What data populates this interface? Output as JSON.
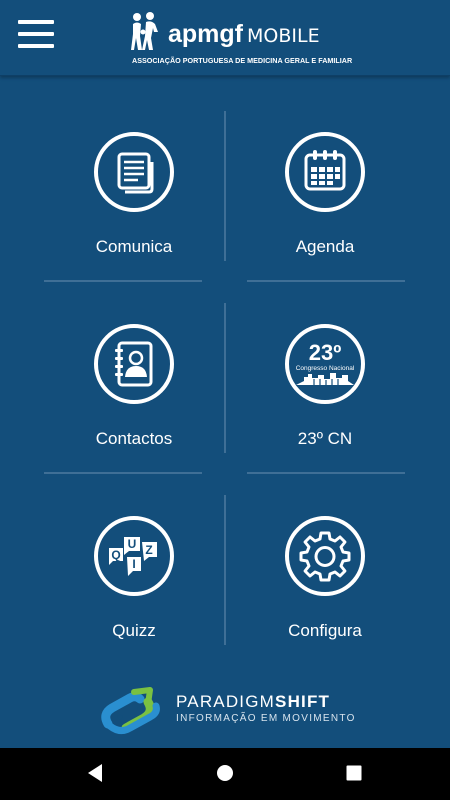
{
  "header": {
    "menu_icon": "hamburger-menu-icon",
    "logo_icon": "apmgf-figures-logo",
    "brand": "apmgf",
    "brand_suffix": "MOBILE",
    "brand_subtitle": "ASSOCIAÇÃO PORTUGUESA DE MEDICINA GERAL E FAMILIAR"
  },
  "menu": {
    "items": [
      {
        "label": "Comunica",
        "icon": "documents-icon"
      },
      {
        "label": "Agenda",
        "icon": "calendar-icon"
      },
      {
        "label": "Contactos",
        "icon": "address-book-icon"
      },
      {
        "label": "23º CN",
        "icon": "congress-badge-icon",
        "badge_number": "23º",
        "badge_text": "Congresso Nacional"
      },
      {
        "label": "Quizz",
        "icon": "quiz-speech-bubbles-icon",
        "letters": [
          "Q",
          "U",
          "I",
          "Z"
        ]
      },
      {
        "label": "Configura",
        "icon": "gear-icon"
      }
    ]
  },
  "footer": {
    "brand_light": "PARADIGM",
    "brand_bold": "SHIFT",
    "tagline": "INFORMAÇÃO EM MOVIMENTO",
    "logo_colors": [
      "#2a8fd0",
      "#7ac142"
    ]
  },
  "navbar": {
    "back_icon": "back-triangle-icon",
    "home_icon": "home-circle-icon",
    "recents_icon": "recents-square-icon"
  },
  "colors": {
    "background": "#134e7b",
    "divider": "#3f6f96",
    "text": "#ffffff",
    "navbar": "#000000"
  }
}
